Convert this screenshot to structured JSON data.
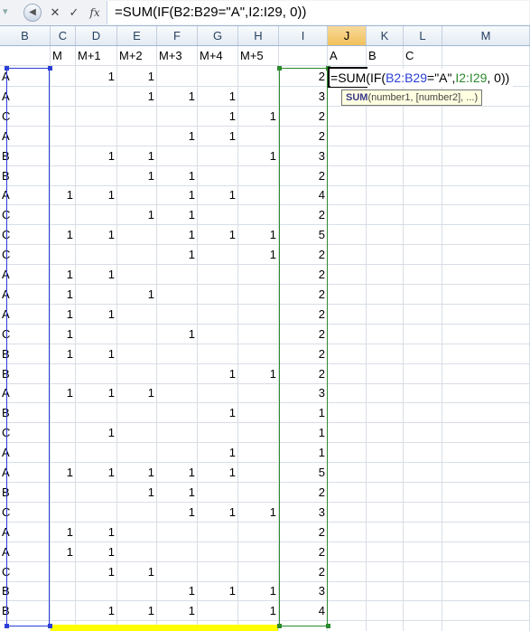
{
  "formula_bar": {
    "cancel_icon": "✕",
    "enter_icon": "✓",
    "fx_label": "fx",
    "formula": "=SUM(IF(B2:B29=\"A\",I2:I29, 0))"
  },
  "columns": [
    "B",
    "C",
    "D",
    "E",
    "F",
    "G",
    "H",
    "I",
    "J",
    "K",
    "L",
    "M"
  ],
  "selected_column": "J",
  "header_row": {
    "B": "",
    "C": "M",
    "D": "M+1",
    "E": "M+2",
    "F": "M+3",
    "G": "M+4",
    "H": "M+5",
    "I": "",
    "J": "A",
    "K": "B",
    "L": "C",
    "M": ""
  },
  "rows": [
    {
      "B": "A",
      "C": "",
      "D": "1",
      "E": "1",
      "F": "",
      "G": "",
      "H": "",
      "I": "2"
    },
    {
      "B": "A",
      "C": "",
      "D": "",
      "E": "1",
      "F": "1",
      "G": "1",
      "H": "",
      "I": "3"
    },
    {
      "B": "C",
      "C": "",
      "D": "",
      "E": "",
      "F": "",
      "G": "1",
      "H": "1",
      "I": "2"
    },
    {
      "B": "A",
      "C": "",
      "D": "",
      "E": "",
      "F": "1",
      "G": "1",
      "H": "",
      "I": "2"
    },
    {
      "B": "B",
      "C": "",
      "D": "1",
      "E": "1",
      "F": "",
      "G": "",
      "H": "1",
      "I": "3"
    },
    {
      "B": "B",
      "C": "",
      "D": "",
      "E": "1",
      "F": "1",
      "G": "",
      "H": "",
      "I": "2"
    },
    {
      "B": "A",
      "C": "1",
      "D": "1",
      "E": "",
      "F": "1",
      "G": "1",
      "H": "",
      "I": "4"
    },
    {
      "B": "C",
      "C": "",
      "D": "",
      "E": "1",
      "F": "1",
      "G": "",
      "H": "",
      "I": "2"
    },
    {
      "B": "C",
      "C": "1",
      "D": "1",
      "E": "",
      "F": "1",
      "G": "1",
      "H": "1",
      "I": "5"
    },
    {
      "B": "C",
      "C": "",
      "D": "",
      "E": "",
      "F": "1",
      "G": "",
      "H": "1",
      "I": "2"
    },
    {
      "B": "A",
      "C": "1",
      "D": "1",
      "E": "",
      "F": "",
      "G": "",
      "H": "",
      "I": "2"
    },
    {
      "B": "A",
      "C": "1",
      "D": "",
      "E": "1",
      "F": "",
      "G": "",
      "H": "",
      "I": "2"
    },
    {
      "B": "A",
      "C": "1",
      "D": "1",
      "E": "",
      "F": "",
      "G": "",
      "H": "",
      "I": "2"
    },
    {
      "B": "C",
      "C": "1",
      "D": "",
      "E": "",
      "F": "1",
      "G": "",
      "H": "",
      "I": "2"
    },
    {
      "B": "B",
      "C": "1",
      "D": "1",
      "E": "",
      "F": "",
      "G": "",
      "H": "",
      "I": "2"
    },
    {
      "B": "B",
      "C": "",
      "D": "",
      "E": "",
      "F": "",
      "G": "1",
      "H": "1",
      "I": "2"
    },
    {
      "B": "A",
      "C": "1",
      "D": "1",
      "E": "1",
      "F": "",
      "G": "",
      "H": "",
      "I": "3"
    },
    {
      "B": "B",
      "C": "",
      "D": "",
      "E": "",
      "F": "",
      "G": "1",
      "H": "",
      "I": "1"
    },
    {
      "B": "C",
      "C": "",
      "D": "1",
      "E": "",
      "F": "",
      "G": "",
      "H": "",
      "I": "1"
    },
    {
      "B": "A",
      "C": "",
      "D": "",
      "E": "",
      "F": "",
      "G": "1",
      "H": "",
      "I": "1"
    },
    {
      "B": "A",
      "C": "1",
      "D": "1",
      "E": "1",
      "F": "1",
      "G": "1",
      "H": "",
      "I": "5"
    },
    {
      "B": "B",
      "C": "",
      "D": "",
      "E": "1",
      "F": "1",
      "G": "",
      "H": "",
      "I": "2"
    },
    {
      "B": "C",
      "C": "",
      "D": "",
      "E": "",
      "F": "1",
      "G": "1",
      "H": "1",
      "I": "3"
    },
    {
      "B": "A",
      "C": "1",
      "D": "1",
      "E": "",
      "F": "",
      "G": "",
      "H": "",
      "I": "2"
    },
    {
      "B": "A",
      "C": "1",
      "D": "1",
      "E": "",
      "F": "",
      "G": "",
      "H": "",
      "I": "2"
    },
    {
      "B": "C",
      "C": "",
      "D": "1",
      "E": "1",
      "F": "",
      "G": "",
      "H": "",
      "I": "2"
    },
    {
      "B": "B",
      "C": "",
      "D": "",
      "E": "",
      "F": "1",
      "G": "1",
      "H": "1",
      "I": "3"
    },
    {
      "B": "B",
      "C": "",
      "D": "1",
      "E": "1",
      "F": "1",
      "G": "",
      "H": "1",
      "I": "4"
    }
  ],
  "edit": {
    "eq": "=",
    "fn": "SUM(IF(",
    "range1": "B2:B29",
    "mid": "=\"A\",",
    "range2": "I2:I29",
    "tail": ", 0))"
  },
  "tooltip": {
    "fn": "SUM",
    "args": "(number1, [number2], ...)"
  },
  "colors": {
    "range_blue": "#2b3fd6",
    "range_green": "#2c8a2c",
    "highlight_yellow": "#ffff00",
    "header_selected": "#f1c15a"
  }
}
